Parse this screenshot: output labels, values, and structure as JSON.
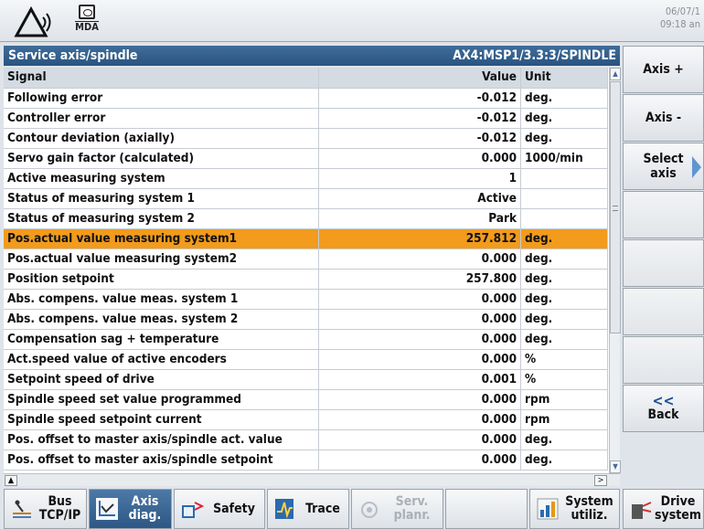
{
  "header": {
    "mode_label": "MDA",
    "date": "06/07/1",
    "time": "09:18 an"
  },
  "title": {
    "left": "Service axis/spindle",
    "right": "AX4:MSP1/3.3:3/SPINDLE"
  },
  "table": {
    "columns": {
      "signal": "Signal",
      "value": "Value",
      "unit": "Unit"
    },
    "rows": [
      {
        "signal": "Following error",
        "value": "-0.012",
        "unit": "deg."
      },
      {
        "signal": "Controller error",
        "value": "-0.012",
        "unit": "deg."
      },
      {
        "signal": "Contour deviation (axially)",
        "value": "-0.012",
        "unit": "deg."
      },
      {
        "signal": "Servo gain factor (calculated)",
        "value": "0.000",
        "unit": "1000/min"
      },
      {
        "signal": "Active measuring system",
        "value": "1",
        "unit": ""
      },
      {
        "signal": "Status of measuring system 1",
        "value": "Active",
        "unit": ""
      },
      {
        "signal": "Status of measuring system 2",
        "value": "Park",
        "unit": ""
      },
      {
        "signal": "Pos.actual value measuring system1",
        "value": "257.812",
        "unit": "deg.",
        "selected": true
      },
      {
        "signal": "Pos.actual value measuring system2",
        "value": "0.000",
        "unit": "deg."
      },
      {
        "signal": "Position setpoint",
        "value": "257.800",
        "unit": "deg."
      },
      {
        "signal": "Abs. compens. value meas. system 1",
        "value": "0.000",
        "unit": "deg."
      },
      {
        "signal": "Abs. compens. value meas. system 2",
        "value": "0.000",
        "unit": "deg."
      },
      {
        "signal": "Compensation sag + temperature",
        "value": "0.000",
        "unit": "deg."
      },
      {
        "signal": "Act.speed value of active encoders",
        "value": "0.000",
        "unit": "%"
      },
      {
        "signal": "Setpoint speed of drive",
        "value": "0.001",
        "unit": "%"
      },
      {
        "signal": "Spindle speed set value programmed",
        "value": "0.000",
        "unit": "rpm"
      },
      {
        "signal": "Spindle speed setpoint current",
        "value": "0.000",
        "unit": "rpm"
      },
      {
        "signal": "Pos. offset to master axis/spindle act. value",
        "value": "0.000",
        "unit": "deg."
      },
      {
        "signal": "Pos. offset to master axis/spindle setpoint",
        "value": "0.000",
        "unit": "deg."
      }
    ]
  },
  "vertical_softkeys": {
    "axis_plus": "Axis +",
    "axis_minus": "Axis -",
    "select_line1": "Select",
    "select_line2": "axis",
    "back_icon": "<<",
    "back": "Back"
  },
  "horizontal_softkeys": {
    "bus_line1": "Bus",
    "bus_line2": "TCP/IP",
    "axis_line1": "Axis",
    "axis_line2": "diag.",
    "safety": "Safety",
    "trace": "Trace",
    "serv_line1": "Serv.",
    "serv_line2": "planr.",
    "sysutil_line1": "System",
    "sysutil_line2": "utiliz.",
    "drive_line1": "Drive",
    "drive_line2": "system"
  },
  "colors": {
    "title_bar": "#2f5b88",
    "selected_row": "#f29b1c",
    "active_softkey": "#3a6896"
  }
}
